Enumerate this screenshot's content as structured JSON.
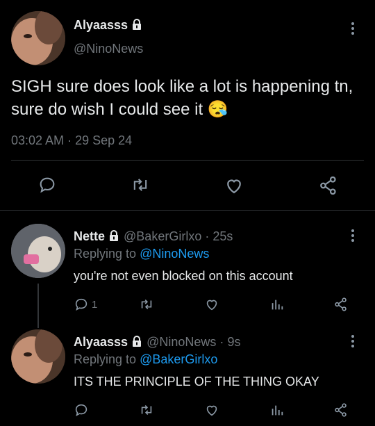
{
  "main_tweet": {
    "display_name": "Alyaasss",
    "handle": "@NinoNews",
    "text": "SIGH sure does look like a lot is happening tn, sure do wish I could see it",
    "emoji": "😪",
    "time": "03:02 AM",
    "sep": "·",
    "date": "29 Sep 24",
    "icons": [
      "reply-icon",
      "retweet-icon",
      "like-icon",
      "share-icon"
    ]
  },
  "replies": [
    {
      "display_name": "Nette",
      "handle": "@BakerGirlxo",
      "sep": "·",
      "age": "25s",
      "replying_prefix": "Replying to",
      "replying_to": "@NinoNews",
      "text": "you're not even blocked on this account",
      "reply_count": "1"
    },
    {
      "display_name": "Alyaasss",
      "handle": "@NinoNews",
      "sep": "·",
      "age": "9s",
      "replying_prefix": "Replying to",
      "replying_to": "@BakerGirlxo",
      "text": "ITS THE PRINCIPLE OF THE THING OKAY",
      "reply_count": ""
    }
  ],
  "colors": {
    "background": "#000000",
    "link": "#1d9bf0",
    "muted": "#71767b",
    "icon": "#8b98a5"
  }
}
